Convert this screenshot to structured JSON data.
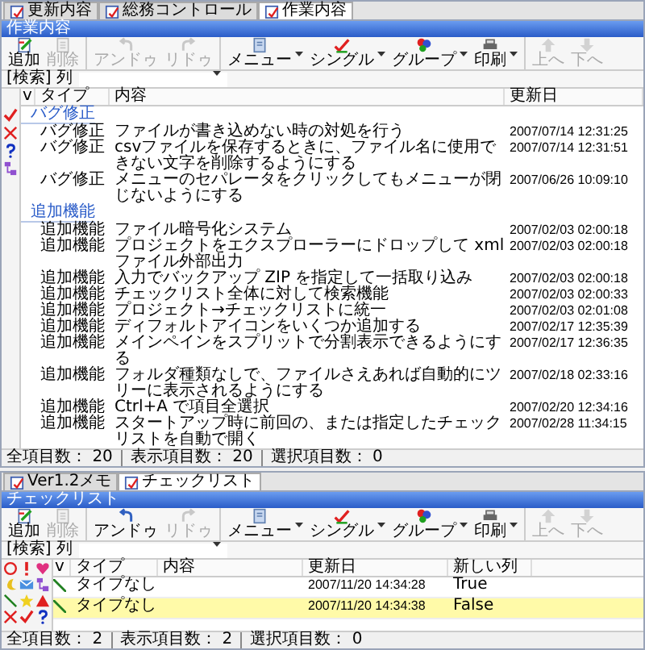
{
  "top_panel": {
    "tabs": [
      {
        "label": "更新内容",
        "selected": false
      },
      {
        "label": "総務コントロール",
        "selected": false
      },
      {
        "label": "作業内容",
        "selected": true
      }
    ],
    "title": "作業内容",
    "toolbar": [
      {
        "label": "追加",
        "kind": "add",
        "disabled": false,
        "dropdown": false
      },
      {
        "label": "削除",
        "kind": "delete",
        "disabled": true,
        "dropdown": false
      },
      {
        "label": "アンドゥ",
        "kind": "undo",
        "disabled": true,
        "dropdown": false
      },
      {
        "label": "リドゥ",
        "kind": "redo",
        "disabled": true,
        "dropdown": false
      },
      {
        "label": "メニュー",
        "kind": "menu",
        "disabled": false,
        "dropdown": true
      },
      {
        "label": "シングル",
        "kind": "single",
        "disabled": false,
        "dropdown": true
      },
      {
        "label": "グループ",
        "kind": "group",
        "disabled": false,
        "dropdown": true
      },
      {
        "label": "印刷",
        "kind": "print",
        "disabled": false,
        "dropdown": true
      },
      {
        "label": "上へ",
        "kind": "up",
        "disabled": true,
        "dropdown": false
      },
      {
        "label": "下へ",
        "kind": "down",
        "disabled": true,
        "dropdown": false
      }
    ],
    "search_label": "[検索] 列",
    "columns": [
      "v",
      "タイプ",
      "内容",
      "更新日"
    ],
    "side_icons": [
      {
        "kind": "check"
      },
      {
        "kind": "cross"
      },
      {
        "kind": "question"
      },
      {
        "kind": "flow"
      }
    ],
    "groups": [
      {
        "label": "バグ修正",
        "rows": [
          {
            "type": "バグ修正",
            "content": "ファイルが書き込めない時の対処を行う",
            "date": "2007/07/14 12:31:25"
          },
          {
            "type": "バグ修正",
            "content": "csvファイルを保存するときに、ファイル名に使用できない文字を削除するようにする",
            "date": "2007/07/14 12:31:51"
          },
          {
            "type": "バグ修正",
            "content": "メニューのセパレータをクリックしてもメニューが閉じないようにする",
            "date": "2007/06/26 10:09:10"
          }
        ]
      },
      {
        "label": "追加機能",
        "rows": [
          {
            "type": "追加機能",
            "content": "ファイル暗号化システム",
            "date": "2007/02/03 02:00:18"
          },
          {
            "type": "追加機能",
            "content": "プロジェクトをエクスプローラーにドロップして xml ファイル外部出力",
            "date": "2007/02/03 02:00:18"
          },
          {
            "type": "追加機能",
            "content": "入力でバックアップ ZIP を指定して一括取り込み",
            "date": "2007/02/03 02:00:18"
          },
          {
            "type": "追加機能",
            "content": "チェックリスト全体に対して検索機能",
            "date": "2007/02/03 02:00:33"
          },
          {
            "type": "追加機能",
            "content": "プロジェクト→チェックリストに統一",
            "date": "2007/02/03 02:01:08"
          },
          {
            "type": "追加機能",
            "content": "ディフォルトアイコンをいくつか追加する",
            "date": "2007/02/17 12:35:39"
          },
          {
            "type": "追加機能",
            "content": "メインペインをスプリットで分割表示できるようにする",
            "date": "2007/02/17 12:36:35"
          },
          {
            "type": "追加機能",
            "content": "フォルダ種類なしで、ファイルさえあれば自動的にツリーに表示されるようにする",
            "date": "2007/02/18 02:33:16"
          },
          {
            "type": "追加機能",
            "content": "Ctrl+A で項目全選択",
            "date": "2007/02/20 12:34:16"
          },
          {
            "type": "追加機能",
            "content": "スタートアップ時に前回の、または指定したチェックリストを自動で開く",
            "date": "2007/02/28 11:34:15"
          }
        ]
      }
    ],
    "status": [
      {
        "label": "全項目数：",
        "value": "20"
      },
      {
        "label": "表示項目数：",
        "value": "20"
      },
      {
        "label": "選択項目数：",
        "value": "0"
      }
    ]
  },
  "bottom_panel": {
    "tabs": [
      {
        "label": "Ver1.2メモ",
        "selected": false
      },
      {
        "label": "チェックリスト",
        "selected": true
      }
    ],
    "title": "チェックリスト",
    "toolbar": [
      {
        "label": "追加",
        "kind": "add",
        "disabled": false,
        "dropdown": false
      },
      {
        "label": "削除",
        "kind": "delete",
        "disabled": true,
        "dropdown": false
      },
      {
        "label": "アンドゥ",
        "kind": "undo",
        "disabled": false,
        "dropdown": false
      },
      {
        "label": "リドゥ",
        "kind": "redo",
        "disabled": true,
        "dropdown": false
      },
      {
        "label": "メニュー",
        "kind": "menu",
        "disabled": false,
        "dropdown": true
      },
      {
        "label": "シングル",
        "kind": "single",
        "disabled": false,
        "dropdown": true
      },
      {
        "label": "グループ",
        "kind": "group",
        "disabled": false,
        "dropdown": true
      },
      {
        "label": "印刷",
        "kind": "print",
        "disabled": false,
        "dropdown": true
      },
      {
        "label": "上へ",
        "kind": "up",
        "disabled": true,
        "dropdown": false
      },
      {
        "label": "下へ",
        "kind": "down",
        "disabled": true,
        "dropdown": false
      }
    ],
    "search_label": "[検索] 列",
    "columns": [
      "v",
      "タイプ",
      "内容",
      "更新日",
      "新しい列"
    ],
    "side_icons": [
      {
        "kind": "circle"
      },
      {
        "kind": "exclamation"
      },
      {
        "kind": "heart"
      },
      {
        "kind": "moon"
      },
      {
        "kind": "envelope"
      },
      {
        "kind": "flow"
      },
      {
        "kind": "line"
      },
      {
        "kind": "star"
      },
      {
        "kind": "triangle"
      },
      {
        "kind": "cross"
      },
      {
        "kind": "check"
      },
      {
        "kind": "question"
      }
    ],
    "rows": [
      {
        "type": "タイプなし",
        "date": "2007/11/20 14:34:28",
        "new_column": "True",
        "selected": false
      },
      {
        "type": "タイプなし",
        "date": "2007/11/20 14:34:38",
        "new_column": "False",
        "selected": true
      }
    ],
    "status": [
      {
        "label": "全項目数：",
        "value": "2"
      },
      {
        "label": "表示項目数：",
        "value": "2"
      },
      {
        "label": "選択項目数：",
        "value": "0"
      }
    ]
  }
}
